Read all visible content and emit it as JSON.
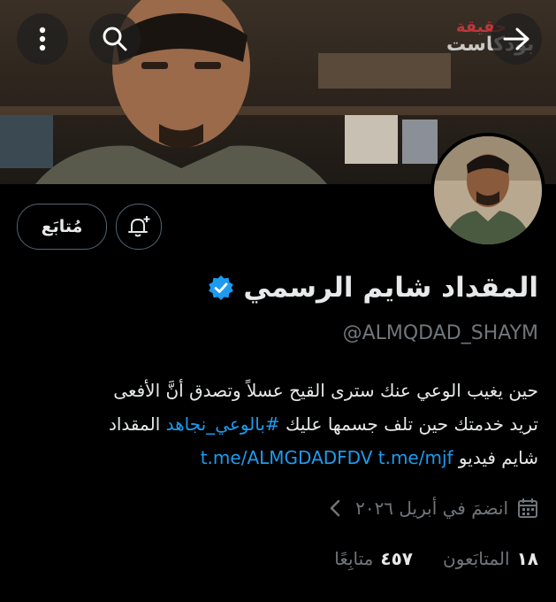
{
  "header": {
    "watermark_top": "بودكاست",
    "watermark_sub": "حقيقة",
    "back_icon": "arrow-forward-icon",
    "search_icon": "search-icon",
    "more_icon": "more-vertical-icon"
  },
  "actions": {
    "follow_label": "مُتابَع",
    "notify_icon": "bell-plus-icon"
  },
  "profile": {
    "display_name": "المقداد شايم الرسمي",
    "verified_icon": "verified-badge-icon",
    "handle": "@ALMQDAD_SHAYM",
    "bio_lines": {
      "line1": "حين يغيب الوعي عنك سترى القيح عسلاً وتصدق أنَّ الأفعى",
      "line2_pre": "تريد خدمتك حين تلف جسمها عليك",
      "hashtag": "#بالوعي_نجاهد",
      "line2_post": "المقداد",
      "line3_pre": "شايم فيديو",
      "link1": "t.me/mjf",
      "link2": "t.me/ALMGDADFDV"
    },
    "joined": "انضمَ في أبريل ٢٠٢٦",
    "joined_icon": "calendar-icon",
    "joined_chevron_icon": "chevron-left-icon"
  },
  "stats": {
    "followers_count": "١٨",
    "followers_label": "المتابَعون",
    "following_count": "٤٥٧",
    "following_label": "متابِعًا"
  },
  "colors": {
    "background": "#000000",
    "text": "#e7e9ea",
    "muted": "#71767b",
    "link": "#1d9bf0",
    "verified": "#1d9bf0"
  }
}
